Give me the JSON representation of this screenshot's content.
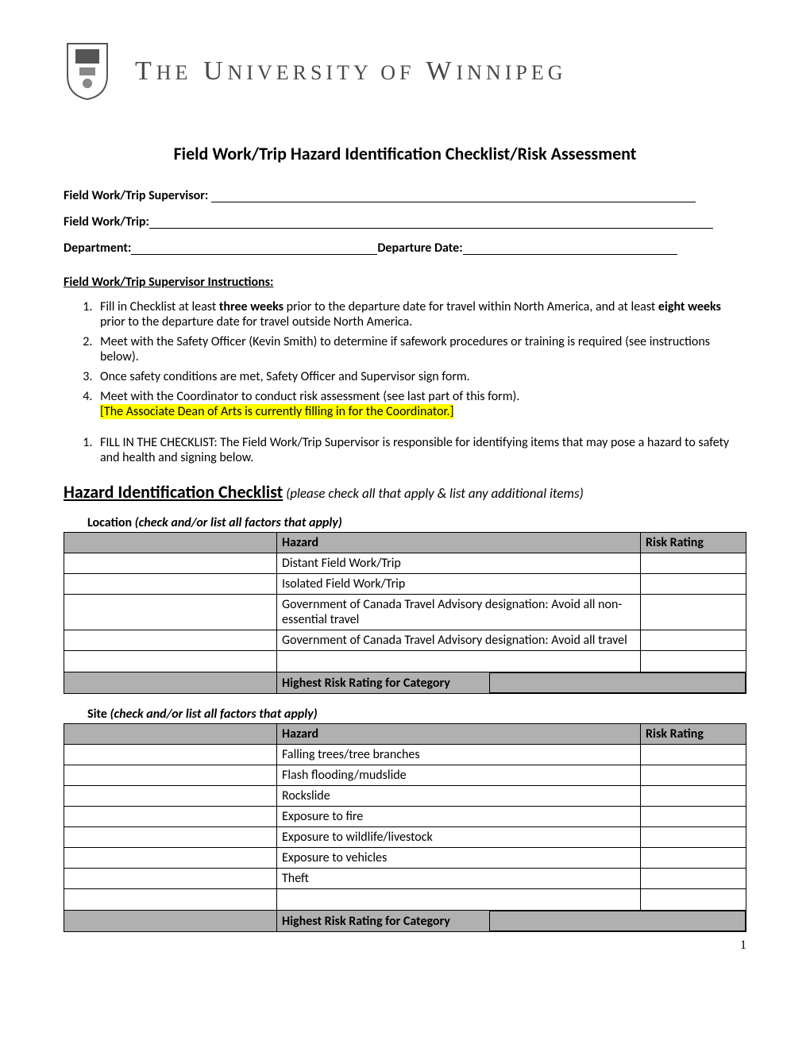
{
  "header": {
    "university": "The University of Winnipeg"
  },
  "title": "Field Work/Trip Hazard Identification Checklist/Risk Assessment",
  "form": {
    "supervisor_label": "Field Work/Trip Supervisor:",
    "trip_label": "Field Work/Trip:",
    "department_label": "Department:",
    "departure_label": "Departure Date:"
  },
  "instructions_heading": "Field Work/Trip Supervisor Instructions:",
  "instructions": {
    "i1a": "Fill in Checklist at least ",
    "i1b": "three weeks",
    "i1c": " prior to the departure date for travel within North America, and at least ",
    "i1d": "eight weeks",
    "i1e": " prior to the departure date for travel outside North America.",
    "i2": "Meet with the Safety Officer (Kevin Smith)  to determine if safework procedures or training is required (see instructions below).",
    "i3": "Once safety conditions are met, Safety Officer and Supervisor sign form.",
    "i4a": " Meet with the Coordinator to conduct risk assessment (see last part of this form).",
    "i4b": "[The Associate Dean of Arts is currently filling in for the Coordinator.]",
    "fill": "FILL IN THE CHECKLIST: The Field Work/Trip Supervisor is responsible for identifying items that may pose a hazard to safety and health and signing below."
  },
  "checklist": {
    "title": "Hazard Identification Checklist",
    "subtitle": " (please check all that apply & list any additional items)",
    "hazard_header": "Hazard",
    "rating_header": "Risk Rating",
    "highest_label": "Highest Risk Rating for Category",
    "location": {
      "heading": "Location",
      "sub": " (check and/or list all factors that apply)",
      "rows": [
        "Distant Field Work/Trip",
        "Isolated Field Work/Trip",
        "Government of Canada Travel Advisory designation: Avoid all non-essential travel",
        "Government of Canada Travel Advisory designation: Avoid all travel"
      ]
    },
    "site": {
      "heading": "Site",
      "sub": " (check and/or list all factors that apply)",
      "rows": [
        "Falling trees/tree branches",
        "Flash flooding/mudslide",
        "Rockslide",
        "Exposure to fire",
        "Exposure to wildlife/livestock",
        "Exposure to vehicles",
        "Theft"
      ]
    }
  },
  "page_number": "1"
}
